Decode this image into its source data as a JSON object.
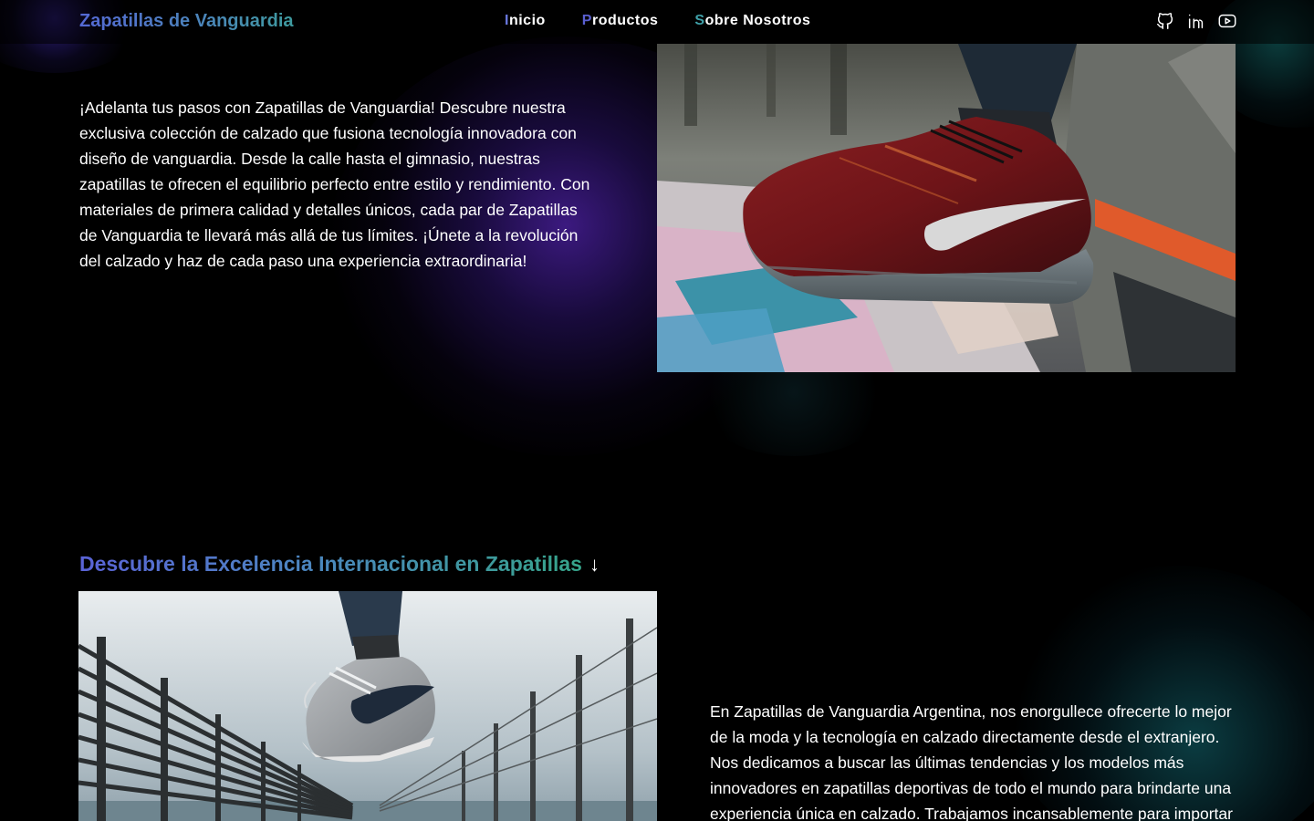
{
  "header": {
    "brand": "Zapatillas de Vanguardia",
    "nav": [
      {
        "first": "I",
        "rest": "nicio"
      },
      {
        "first": "P",
        "rest": "roductos"
      },
      {
        "first": "S",
        "rest": "obre Nosotros"
      }
    ],
    "social_icons": [
      "github-icon",
      "linkedin-icon",
      "youtube-icon"
    ]
  },
  "intro": {
    "text": "¡Adelanta tus pasos con Zapatillas de Vanguardia! Descubre nuestra exclusiva colección de calzado que fusiona tecnología innovadora con diseño de vanguardia. Desde la calle hasta el gimnasio, nuestras zapatillas te ofrecen el equilibrio perfecto entre estilo y rendimiento. Con materiales de primera calidad y detalles únicos, cada par de Zapatillas de Vanguardia te llevará más allá de tus límites. ¡Únete a la revolución del calzado y haz de cada paso una experiencia extraordinaria!"
  },
  "section": {
    "title": "Descubre la Excelencia Internacional en Zapatillas",
    "arrow": "↓",
    "text": "En Zapatillas de Vanguardia Argentina, nos enorgullece ofrecerte lo mejor de la moda y la tecnología en calzado directamente desde el extranjero. Nos dedicamos a buscar las últimas tendencias y los modelos más innovadores en zapatillas deportivas de todo el mundo para brindarte una experiencia única en calzado. Trabajamos incansablemente para importar estas zapatillas exclusivas y ponerlas a tu alcance."
  },
  "colors": {
    "background": "#000000",
    "brand_gradient_start": "#5468d4",
    "brand_gradient_end": "#3e9a9e",
    "glow_purple": "#2d146e",
    "glow_teal": "#146e78"
  }
}
